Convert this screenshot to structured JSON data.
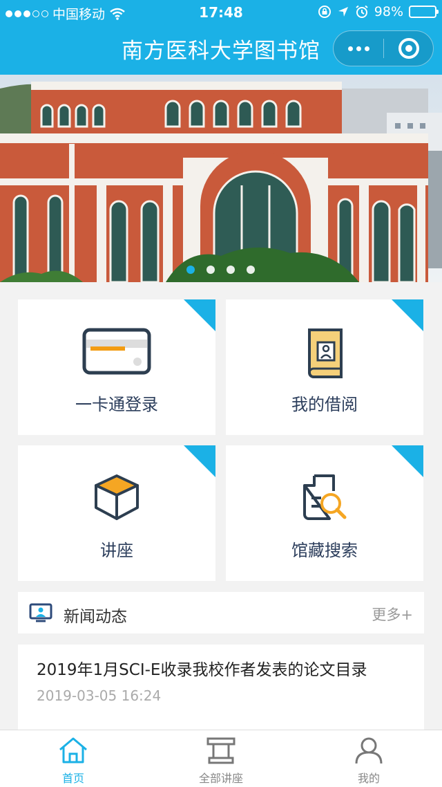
{
  "status_bar": {
    "carrier": "中国移动",
    "time": "17:48",
    "battery": "98%",
    "battery_level": 0.98
  },
  "nav": {
    "title": "南方医科大学图书馆",
    "more_icon": "more-dots-icon",
    "close_icon": "circle-close-icon"
  },
  "banner": {
    "slide_count": 4,
    "active_index": 0
  },
  "grid": [
    {
      "label": "一卡通登录",
      "icon": "card-icon"
    },
    {
      "label": "我的借阅",
      "icon": "book-icon"
    },
    {
      "label": "讲座",
      "icon": "box-icon"
    },
    {
      "label": "馆藏搜索",
      "icon": "document-search-icon"
    }
  ],
  "news": {
    "header": "新闻动态",
    "more": "更多+",
    "items": [
      {
        "title": "2019年1月SCI-E收录我校作者发表的论文目录",
        "time": "2019-03-05 16:24"
      }
    ]
  },
  "tabbar": [
    {
      "label": "首页",
      "active": true
    },
    {
      "label": "全部讲座",
      "active": false
    },
    {
      "label": "我的",
      "active": false
    }
  ],
  "colors": {
    "accent": "#1bb1e6",
    "card_yellow": "#f5d07a",
    "card_stripe": "#f39c12",
    "icon_dark": "#2d3e50"
  }
}
